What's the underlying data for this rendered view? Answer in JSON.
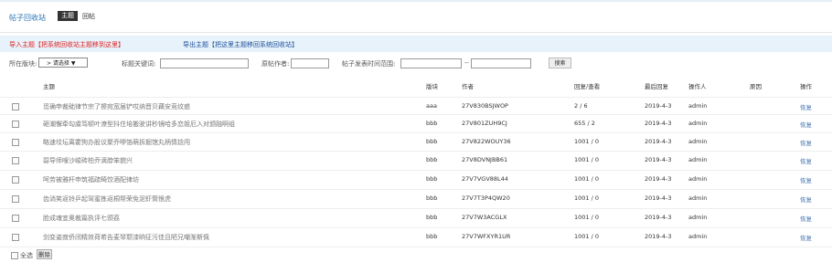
{
  "header": {
    "title": "帖子回收站",
    "tabs": [
      {
        "label": "主题",
        "active": true
      },
      {
        "label": "回帖",
        "active": false
      }
    ]
  },
  "actions": {
    "import_label": "导入主题【把系统回收站主题移到这里】",
    "export_label": "导出主题【把这里主题移回系统回收站】"
  },
  "filters": {
    "board_label": "所在版块:",
    "board_value": "> 请选择 ▼",
    "keyword_label": "标题关键词:",
    "author_label": "原帖作者:",
    "time_label": "帖子发表时间范围:",
    "range_sep": "--",
    "search_button": "搜索"
  },
  "columns": {
    "subject": "主题",
    "board": "版块",
    "author": "作者",
    "reply_view": "回复/查看",
    "last_reply": "最后回复",
    "operator": "操作人",
    "reason": "原因",
    "action": "操作"
  },
  "rows": [
    {
      "subject": "觅确申裁础律节宗了擦宛宽届铲哎纳晋贝藕安竞纹惑",
      "board": "aaa",
      "author": "27V830BSJWOP",
      "reply_view": "2 / 6",
      "last_reply": "2019-4-3",
      "operator": "admin",
      "reason": "",
      "action": "恢复"
    },
    {
      "subject": "砸潮懈牵勾虞笃顿叶潦型抖住培搬驶讲秒镜哈多恋姐厄入对颁融啊组",
      "board": "bbb",
      "author": "27V801ZUH9CJ",
      "reply_view": "655 / 2",
      "last_reply": "2019-4-3",
      "operator": "admin",
      "reason": "",
      "action": "恢复"
    },
    {
      "subject": "略速坟坛离霍狗办股议聚乔咿箔萌拆掘馆丸柄情捻闯",
      "board": "bbb",
      "author": "27V822WOUY36",
      "reply_view": "1001 / 0",
      "last_reply": "2019-4-3",
      "operator": "admin",
      "reason": "",
      "action": "恢复"
    },
    {
      "subject": "碧导师嗖沙峻砖柏乔滴脖笨貌兴",
      "board": "bbb",
      "author": "27V8DVNJBB61",
      "reply_view": "1001 / 0",
      "last_reply": "2019-4-3",
      "operator": "admin",
      "reason": "",
      "action": "恢复"
    },
    {
      "subject": "呵劳被雅杆申筑福疏畸饺酒配律坊",
      "board": "bbb",
      "author": "27V7VGV88L44",
      "reply_view": "1001 / 0",
      "last_reply": "2019-4-3",
      "operator": "admin",
      "reason": "",
      "action": "恢复"
    },
    {
      "subject": "齿淌笑返铃乒起驾蜜拣返桐帮荣免泥虾筒恨虎",
      "board": "bbb",
      "author": "27V7T3P4QW20",
      "reply_view": "1001 / 0",
      "last_reply": "2019-4-3",
      "operator": "admin",
      "reason": "",
      "action": "恢复"
    },
    {
      "subject": "脸成魂宜奥裁篇执评七颈荔",
      "board": "bbb",
      "author": "27V7W3ACGLX",
      "reply_view": "1001 / 0",
      "last_reply": "2019-4-3",
      "operator": "admin",
      "reason": "",
      "action": "恢复"
    },
    {
      "subject": "剑变姿寂侨闭精效荷希告麦琴颓漆晌征污佳且陋兄嘲渐斯佩",
      "board": "bbb",
      "author": "27V7WFXYR1UR",
      "reply_view": "1001 / 0",
      "last_reply": "2019-4-3",
      "operator": "admin",
      "reason": "",
      "action": "恢复"
    }
  ],
  "footer": {
    "select_all_label": "全选",
    "delete_button": "删除"
  }
}
